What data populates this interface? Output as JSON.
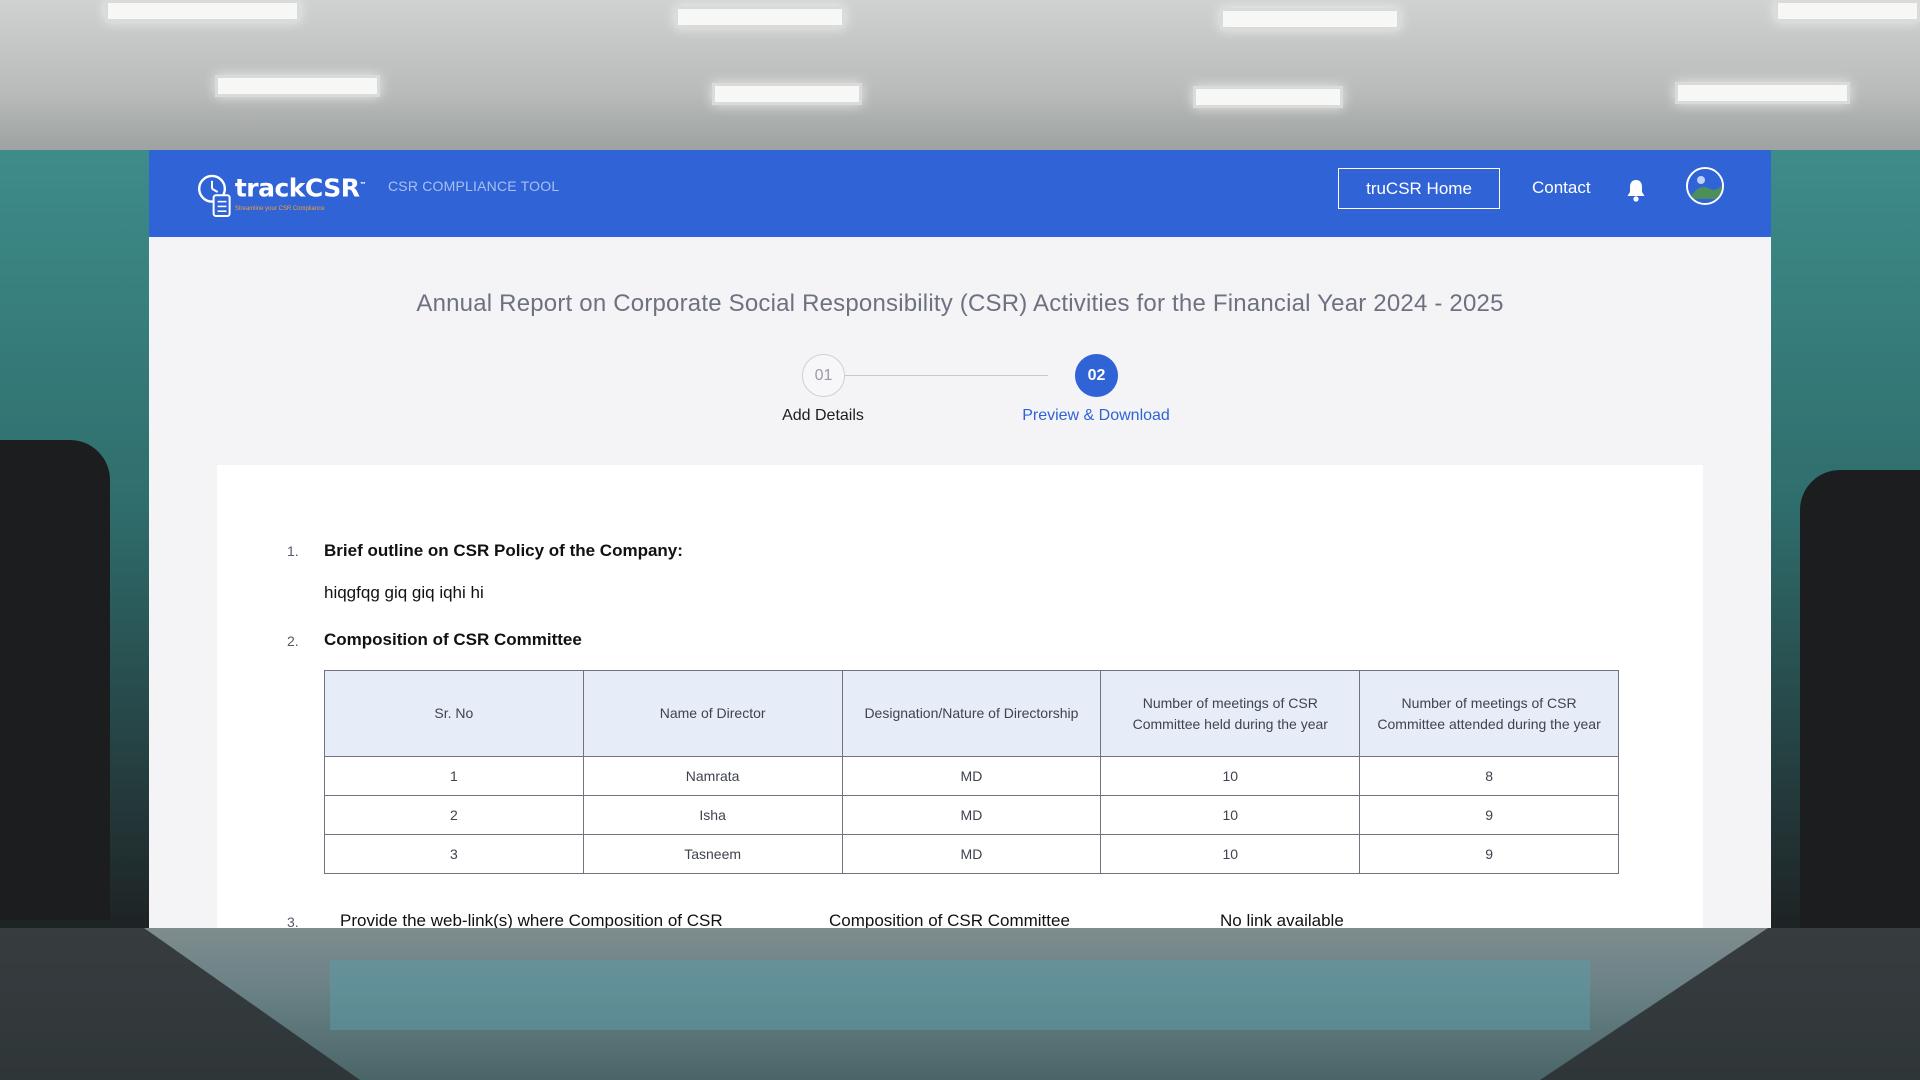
{
  "header": {
    "logo_name": "trackCSR",
    "logo_tagline": "Streamline your CSR Compliance",
    "subtitle": "CSR COMPLIANCE TOOL",
    "home_button": "truCSR Home",
    "contact_link": "Contact",
    "brand_color": "#2f63d6",
    "icons": [
      "bell-icon",
      "avatar"
    ]
  },
  "page": {
    "title": "Annual Report on Corporate Social Responsibility (CSR) Activities for the Financial Year 2024 - 2025"
  },
  "stepper": {
    "steps": [
      {
        "number": "01",
        "label": "Add Details",
        "active": false
      },
      {
        "number": "02",
        "label": "Preview & Download",
        "active": true
      }
    ]
  },
  "report": {
    "section1": {
      "number": "1.",
      "heading": "Brief outline on CSR Policy of the Company:",
      "text": "hiqgfqg giq giq iqhi hi"
    },
    "section2": {
      "number": "2.",
      "heading": "Composition of CSR Committee",
      "table": {
        "columns": [
          "Sr. No",
          "Name of Director",
          "Designation/Nature of Directorship",
          "Number of meetings of CSR Committee held during the year",
          "Number of meetings of CSR Committee attended during the year"
        ],
        "rows": [
          [
            "1",
            "Namrata",
            "MD",
            "10",
            "8"
          ],
          [
            "2",
            "Isha",
            "MD",
            "10",
            "9"
          ],
          [
            "3",
            "Tasneem",
            "MD",
            "10",
            "9"
          ]
        ]
      }
    },
    "section3": {
      "number": "3.",
      "text": "Provide the web-link(s) where Composition of CSR",
      "item": "Composition of CSR Committee",
      "value": "No link available"
    }
  }
}
